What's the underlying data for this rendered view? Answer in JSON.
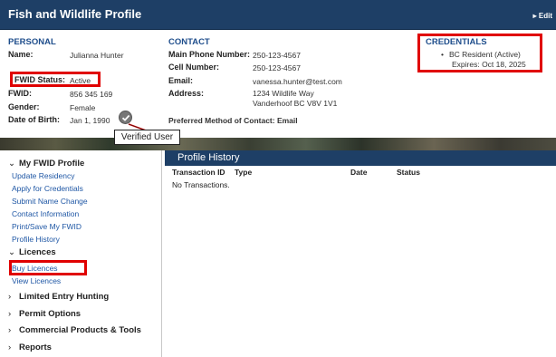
{
  "header": {
    "title": "Fish and Wildlife Profile",
    "edit_label": "▸ Edit"
  },
  "personal": {
    "title": "PERSONAL",
    "name_label": "Name:",
    "name_value": "Julianna Hunter",
    "status_label": "FWID Status:",
    "status_value": "Active",
    "fwid_label": "FWID:",
    "fwid_value": "856 345 169",
    "gender_label": "Gender:",
    "gender_value": "Female",
    "dob_label": "Date of Birth:",
    "dob_value": "Jan 1, 1990"
  },
  "contact": {
    "title": "CONTACT",
    "main_phone_label": "Main Phone Number:",
    "main_phone_value": "250-123-4567",
    "cell_label": "Cell Number:",
    "cell_value": "250-123-4567",
    "email_label": "Email:",
    "email_value": "vanessa.hunter@test.com",
    "address_label": "Address:",
    "address_line1": "1234 Wildlife Way",
    "address_line2": "Vanderhoof BC V8V 1V1",
    "preferred_text": "Preferred Method of Contact: Email"
  },
  "credentials": {
    "title": "CREDENTIALS",
    "item": "BC Resident (Active)",
    "expires": "Expires: Oct 18, 2025"
  },
  "annotation": {
    "callout_text": "Verified User",
    "highlight_color": "#e00000"
  },
  "sidebar": {
    "profile_group": "My FWID Profile",
    "profile_items": [
      "Update Residency",
      "Apply for Credentials",
      "Submit Name Change",
      "Contact Information",
      "Print/Save My FWID",
      "Profile History"
    ],
    "licences_group": "Licences",
    "licence_items": [
      "Buy Licences",
      "View Licences"
    ],
    "other_groups": [
      "Limited Entry Hunting",
      "Permit Options",
      "Commercial Products & Tools",
      "Reports"
    ]
  },
  "profile_history": {
    "title": "Profile History",
    "columns": [
      "Transaction ID",
      "Type",
      "Date",
      "Status"
    ],
    "empty_text": "No Transactions."
  },
  "colors": {
    "navy": "#1e3f66",
    "link": "#1f57a5",
    "section_title": "#1f4e8c"
  }
}
